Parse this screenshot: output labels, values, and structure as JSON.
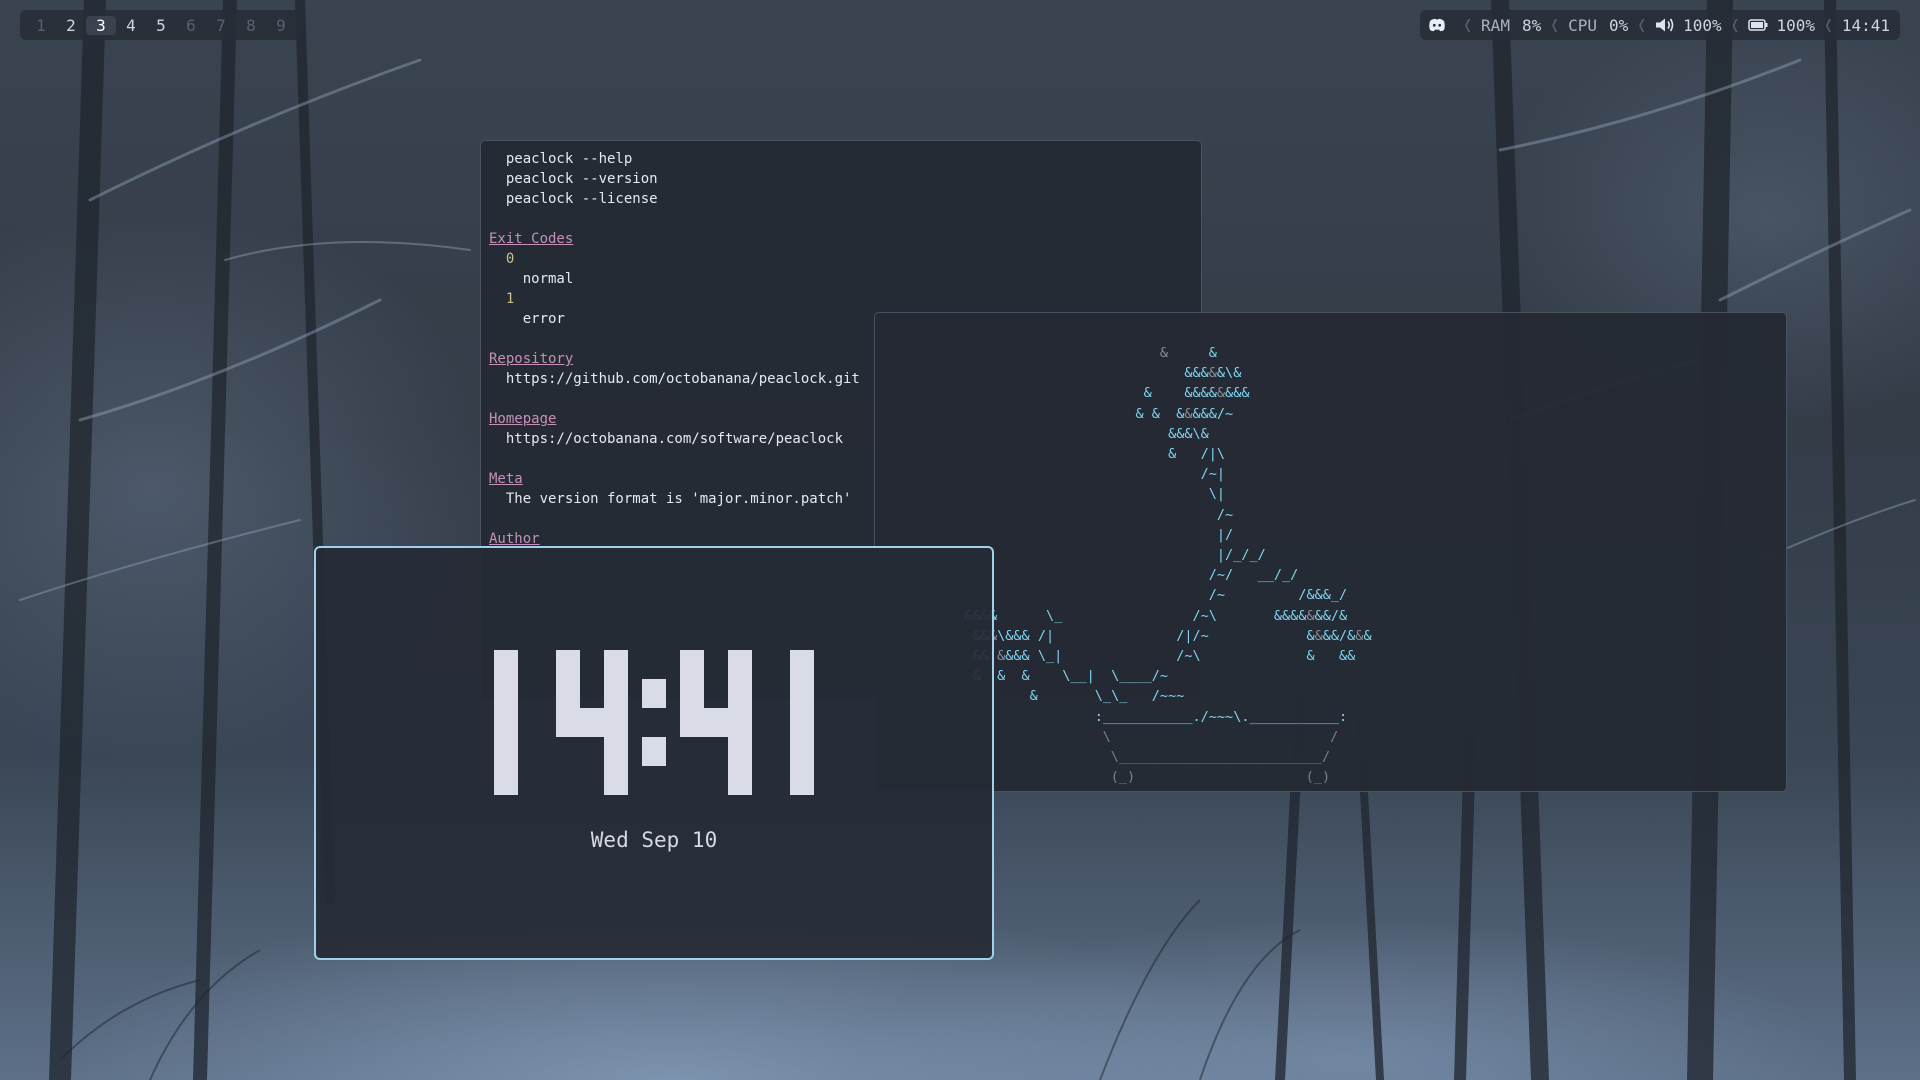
{
  "workspaces": [
    {
      "label": "1",
      "state": "empty"
    },
    {
      "label": "2",
      "state": "occupied"
    },
    {
      "label": "3",
      "state": "active"
    },
    {
      "label": "4",
      "state": "occupied"
    },
    {
      "label": "5",
      "state": "occupied"
    },
    {
      "label": "6",
      "state": "empty"
    },
    {
      "label": "7",
      "state": "empty"
    },
    {
      "label": "8",
      "state": "empty"
    },
    {
      "label": "9",
      "state": "empty"
    }
  ],
  "status": {
    "discord_icon": "discord-icon",
    "ram_label": "RAM",
    "ram_value": "8%",
    "cpu_label": "CPU",
    "cpu_value": "0%",
    "volume_icon": "speaker-icon",
    "volume_value": "100%",
    "battery_icon": "battery-icon",
    "battery_value": "100%",
    "time": "14:41"
  },
  "man_page": {
    "lines": [
      {
        "indent": "  ",
        "text": "peaclock --help"
      },
      {
        "indent": "  ",
        "text": "peaclock --version"
      },
      {
        "indent": "  ",
        "text": "peaclock --license"
      },
      {
        "indent": "",
        "text": ""
      },
      {
        "indent": "",
        "text": "Exit Codes",
        "kind": "header"
      },
      {
        "indent": "  ",
        "text": "0",
        "kind": "num"
      },
      {
        "indent": "    ",
        "text": "normal"
      },
      {
        "indent": "  ",
        "text": "1",
        "kind": "num"
      },
      {
        "indent": "    ",
        "text": "error"
      },
      {
        "indent": "",
        "text": ""
      },
      {
        "indent": "",
        "text": "Repository",
        "kind": "header"
      },
      {
        "indent": "  ",
        "text": "https://github.com/octobanana/peaclock.git"
      },
      {
        "indent": "",
        "text": ""
      },
      {
        "indent": "",
        "text": "Homepage",
        "kind": "header"
      },
      {
        "indent": "  ",
        "text": "https://octobanana.com/software/peaclock"
      },
      {
        "indent": "",
        "text": ""
      },
      {
        "indent": "",
        "text": "Meta",
        "kind": "header"
      },
      {
        "indent": "  ",
        "text": "The version format is 'major.minor.patch'"
      },
      {
        "indent": "",
        "text": ""
      },
      {
        "indent": "",
        "text": "Author",
        "kind": "header"
      }
    ]
  },
  "bonsai": {
    "lines": [
      "                                   &     &",
      "                                      &&&&&\\&",
      "                                 &    &&&&&&&&",
      "                                & &  &&&&&/~",
      "                                    &&&\\&",
      "                                    &   /|\\",
      "                                        /~|",
      "                                         \\|",
      "                                          /~",
      "                                          |/",
      "                                          |/_/_/",
      "                                         /~/   __/_/",
      "                                         /~         /&&&_/",
      "           &&&&      \\_                /~\\       &&&&&&&/&",
      "            &&&\\&&& /|               /|/~            &&&&/&&&",
      "            && &&&& \\_|              /~\\             &   &&",
      "            &  &  &    \\__|  \\____/~",
      "                   &       \\_\\_   /~~~",
      "                           :___________./~~~\\.___________:",
      "                            \\                           /",
      "                             \\_________________________/",
      "                             (_)                     (_)"
    ]
  },
  "clock": {
    "time": "14:41",
    "date": "Wed Sep 10",
    "digit_color": "#d9dce6",
    "border_color": "#9fd2ea"
  }
}
